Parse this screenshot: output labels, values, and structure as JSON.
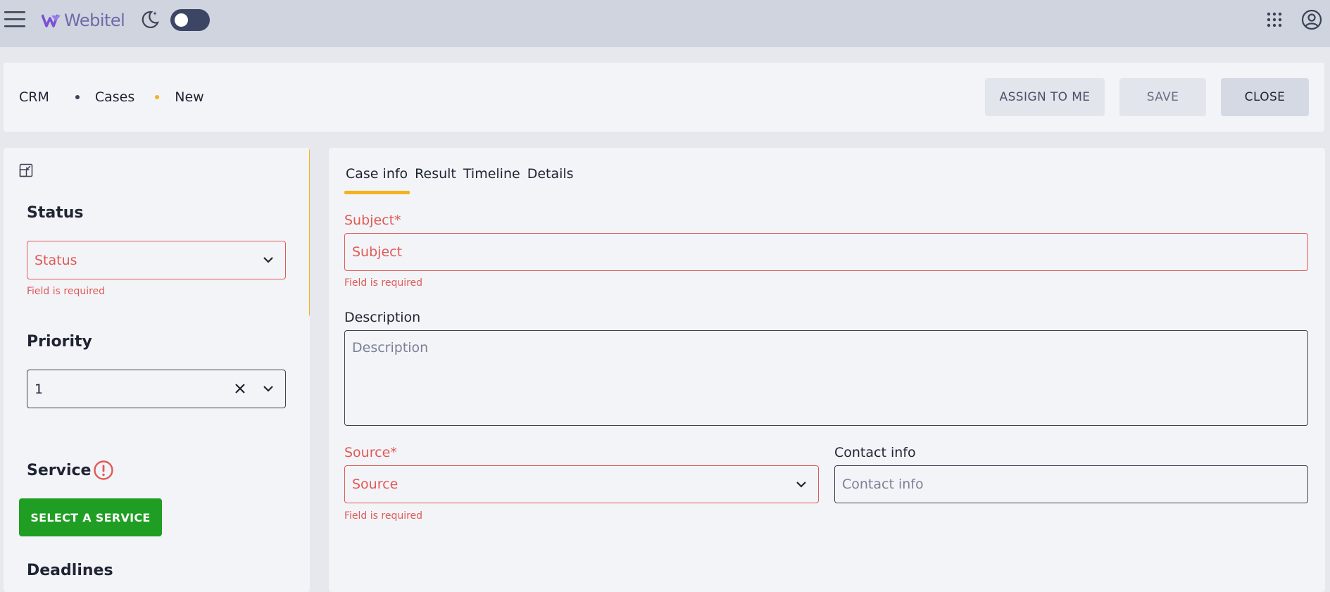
{
  "topbar": {
    "logo_text": "Webitel",
    "theme_toggle_on": false,
    "accent_color": "#f2b31c"
  },
  "breadcrumb": [
    "CRM",
    "Cases",
    "New"
  ],
  "actions": {
    "assign_label": "ASSIGN TO ME",
    "save_label": "SAVE",
    "close_label": "CLOSE"
  },
  "sidebar": {
    "status": {
      "title": "Status",
      "placeholder": "Status",
      "error": "Field is required"
    },
    "priority": {
      "title": "Priority",
      "value": "1"
    },
    "service": {
      "title": "Service",
      "button_label": "SELECT A SERVICE"
    },
    "deadlines": {
      "title": "Deadlines"
    }
  },
  "main": {
    "tabs": [
      "Case info",
      "Result",
      "Timeline",
      "Details"
    ],
    "active_tab": "Case info",
    "subject": {
      "label": "Subject*",
      "placeholder": "Subject",
      "error": "Field is required"
    },
    "description": {
      "label": "Description",
      "placeholder": "Description"
    },
    "source": {
      "label": "Source*",
      "placeholder": "Source",
      "error": "Field is required"
    },
    "contact_info": {
      "label": "Contact info",
      "placeholder": "Contact info"
    }
  }
}
